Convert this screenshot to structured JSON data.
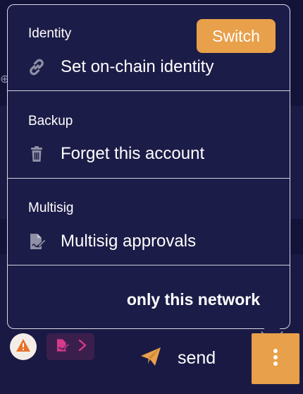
{
  "menu": {
    "identity": {
      "title": "Identity",
      "switch_label": "Switch",
      "item_label": "Set on-chain identity",
      "item_icon": "link-icon"
    },
    "backup": {
      "title": "Backup",
      "item_label": "Forget this account",
      "item_icon": "trash-icon"
    },
    "multisig": {
      "title": "Multisig",
      "item_label": "Multisig approvals",
      "item_icon": "signature-file-icon"
    },
    "network_label": "only this network"
  },
  "bottom_bar": {
    "warning_icon": "warning-icon",
    "multisig_chip_icon": "signature-file-icon",
    "multisig_chip_arrow": "chevron-right-icon",
    "send_icon": "paper-plane-icon",
    "send_label": "send",
    "more_icon": "kebab-vertical-icon"
  },
  "colors": {
    "accent": "#e8a04a",
    "background": "#12123a",
    "menu_background": "#1c1c48",
    "border": "#d9d9e6",
    "warning": "#e8732a",
    "chip_background": "#3a1f4d",
    "chip_icon": "#d63a8a",
    "muted_icon": "#8f8fa6"
  }
}
